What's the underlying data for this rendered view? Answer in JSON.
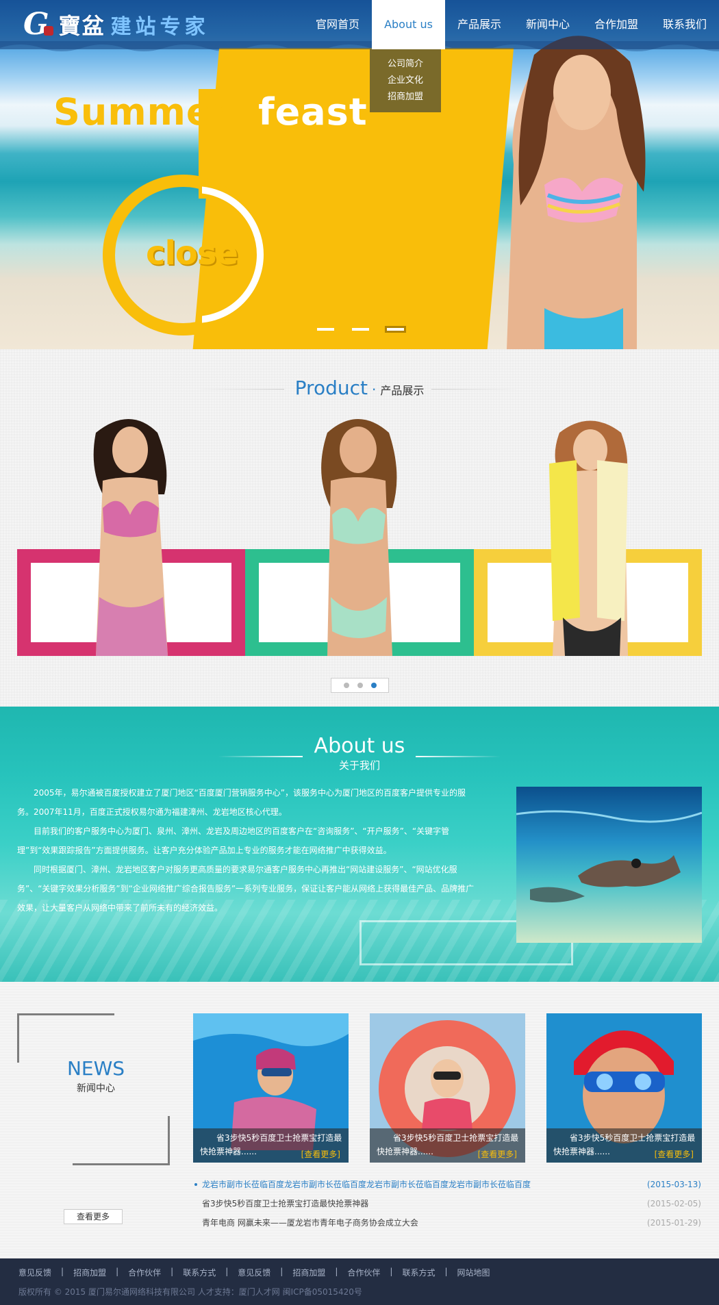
{
  "brand": {
    "logo_mark": "G",
    "logo_text": "寶盆",
    "logo_text2": "建站专家"
  },
  "nav": [
    {
      "label": "官网首页"
    },
    {
      "label": "About us"
    },
    {
      "label": "产品展示"
    },
    {
      "label": "新闻中心"
    },
    {
      "label": "合作加盟"
    },
    {
      "label": "联系我们"
    }
  ],
  "dropdown": [
    {
      "label": "公司简介"
    },
    {
      "label": "企业文化"
    },
    {
      "label": "招商加盟"
    }
  ],
  "banner": {
    "word1": "Summer",
    "word2": "feast",
    "badge": "close",
    "active_slide": 3,
    "slide_count": 3
  },
  "product": {
    "title_en": "Product",
    "title_sep": "·",
    "title_cn": "产品展示",
    "card_colors": [
      "#d6336f",
      "#2dbf8f",
      "#f6cf3c"
    ],
    "active_page": 3
  },
  "about": {
    "title_en": "About us",
    "title_cn": "关于我们",
    "paragraphs": [
      "2005年，易尔通被百度授权建立了厦门地区“百度厦门营销服务中心”，该服务中心为厦门地区的百度客户提供专业的服务。2007年11月，百度正式授权易尔通为福建漳州、龙岩地区核心代理。",
      "目前我们的客户服务中心为厦门、泉州、漳州、龙岩及周边地区的百度客户在“咨询服务”、“开户服务”、“关键字管理”到“效果跟踪报告”方面提供服务。让客户充分体验产品加上专业的服务才能在网络推广中获得效益。",
      "同时根据厦门、漳州、龙岩地区客户对服务更高质量的要求易尔通客户服务中心再推出“网站建设服务”、“网站优化服务”、“关键字效果分析服务”到“企业网络推广综合报告服务”一系列专业服务，保证让客户能从网络上获得最佳产品、品牌推广效果，让大量客户从网络中带来了前所未有的经济效益。"
    ]
  },
  "news": {
    "title_en": "NEWS",
    "title_cn": "新闻中心",
    "more_label": "查看更多",
    "cards": [
      {
        "caption": "省3步快5秒百度卫士抢票宝打造最快抢票神器......",
        "more": "[查看更多]"
      },
      {
        "caption": "省3步快5秒百度卫士抢票宝打造最快抢票神器......",
        "more": "[查看更多]"
      },
      {
        "caption": "省3步快5秒百度卫士抢票宝打造最快抢票神器......",
        "more": "[查看更多]"
      }
    ],
    "list": [
      {
        "title": "龙岩市副市长莅临百度龙岩市副市长莅临百度龙岩市副市长莅临百度龙岩市副市长莅临百度",
        "date": "(2015-03-13)"
      },
      {
        "title": "省3步快5秒百度卫士抢票宝打造最快抢票神器",
        "date": "(2015-02-05)"
      },
      {
        "title": "青年电商 网赢未来——厦龙岩市青年电子商务协会成立大会",
        "date": "(2015-01-29)"
      }
    ]
  },
  "footer": {
    "links": [
      "意见反馈",
      "招商加盟",
      "合作伙伴",
      "联系方式",
      "意见反馈",
      "招商加盟",
      "合作伙伴",
      "联系方式",
      "网站地图"
    ],
    "separator": "|",
    "copyright": "版权所有 © 2015 厦门易尔通网络科技有限公司 人才支持：厦门人才网 闽ICP备05015420号"
  }
}
